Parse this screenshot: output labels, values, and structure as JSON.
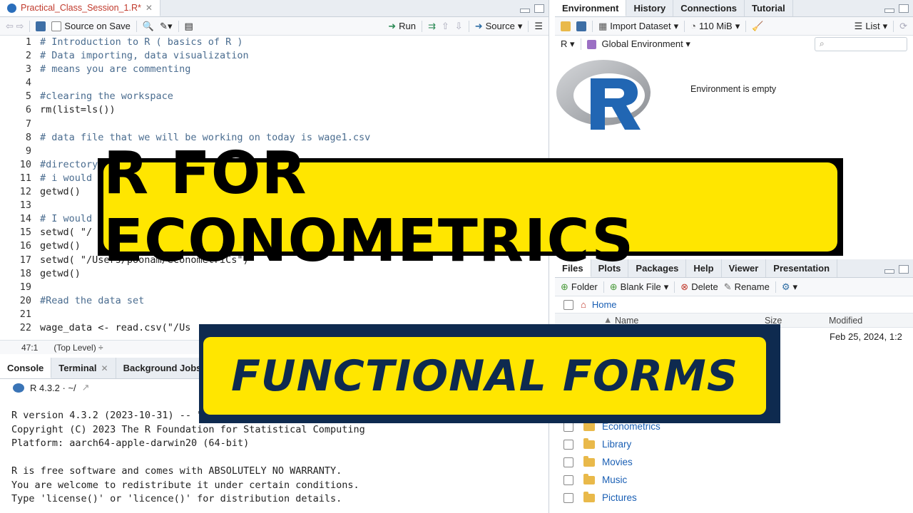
{
  "editor": {
    "tab_label": "Practical_Class_Session_1.R*",
    "source_on_save": "Source on Save",
    "run_label": "Run",
    "source_label": "Source",
    "lines": [
      {
        "n": "1",
        "text": "# Introduction to R ( basics of R )",
        "kind": "comment"
      },
      {
        "n": "2",
        "text": "# Data importing, data visualization",
        "kind": "comment"
      },
      {
        "n": "3",
        "text": "# means you are commenting",
        "kind": "comment"
      },
      {
        "n": "4",
        "text": "",
        "kind": "code"
      },
      {
        "n": "5",
        "text": "#clearing the workspace",
        "kind": "comment"
      },
      {
        "n": "6",
        "text": "rm(list=ls())",
        "kind": "code"
      },
      {
        "n": "7",
        "text": "",
        "kind": "code"
      },
      {
        "n": "8",
        "text": "# data file that we will be working on today is wage1.csv",
        "kind": "comment"
      },
      {
        "n": "9",
        "text": "",
        "kind": "code"
      },
      {
        "n": "10",
        "text": "#directory",
        "kind": "comment"
      },
      {
        "n": "11",
        "text": "# i would",
        "kind": "comment"
      },
      {
        "n": "12",
        "text": "getwd()",
        "kind": "code"
      },
      {
        "n": "13",
        "text": "",
        "kind": "code"
      },
      {
        "n": "14",
        "text": "# I would",
        "kind": "comment"
      },
      {
        "n": "15",
        "text": "setwd( \"/",
        "kind": "code"
      },
      {
        "n": "16",
        "text": "getwd()",
        "kind": "code"
      },
      {
        "n": "17",
        "text": "setwd( \"/Users/poonam/eConometriCs\")",
        "kind": "code"
      },
      {
        "n": "18",
        "text": "getwd()",
        "kind": "code"
      },
      {
        "n": "19",
        "text": "",
        "kind": "code"
      },
      {
        "n": "20",
        "text": "#Read the data set",
        "kind": "comment"
      },
      {
        "n": "21",
        "text": "",
        "kind": "code"
      },
      {
        "n": "22",
        "text": "wage_data <- read.csv(\"/Us",
        "kind": "code"
      }
    ],
    "cursor_pos": "47:1",
    "scope": "(Top Level) ÷"
  },
  "console": {
    "tabs": [
      "Console",
      "Terminal",
      "Background Jobs"
    ],
    "version_label": "R 4.3.2 · ~/",
    "output": [
      "R version 4.3.2 (2023-10-31) -- \"",
      "Copyright (C) 2023 The R Foundation for Statistical Computing",
      "Platform: aarch64-apple-darwin20 (64-bit)",
      "",
      "R is free software and comes with ABSOLUTELY NO WARRANTY.",
      "You are welcome to redistribute it under certain conditions.",
      "Type 'license()' or 'licence()' for distribution details."
    ]
  },
  "environment": {
    "tabs": [
      "Environment",
      "History",
      "Connections",
      "Tutorial"
    ],
    "import_dataset": "Import Dataset",
    "memory": "110 MiB",
    "list_label": "List",
    "r_label": "R",
    "global_env": "Global Environment",
    "empty_msg": "Environment is empty"
  },
  "files": {
    "tabs": [
      "Files",
      "Plots",
      "Packages",
      "Help",
      "Viewer",
      "Presentation"
    ],
    "folder_btn": "Folder",
    "blank_file": "Blank File",
    "delete": "Delete",
    "rename": "Rename",
    "home": "Home",
    "col_name": "Name",
    "col_size": "Size",
    "col_modified": "Modified",
    "first_modified": "Feb 25, 2024, 1:2",
    "items": [
      "Econometrics",
      "Library",
      "Movies",
      "Music",
      "Pictures"
    ]
  },
  "overlay": {
    "title": "R FOR ECONOMETRICS",
    "subtitle": "FUNCTIONAL FORMS"
  },
  "colors": {
    "banner_yellow": "#ffe600",
    "banner_navy": "#0e2a4f"
  }
}
